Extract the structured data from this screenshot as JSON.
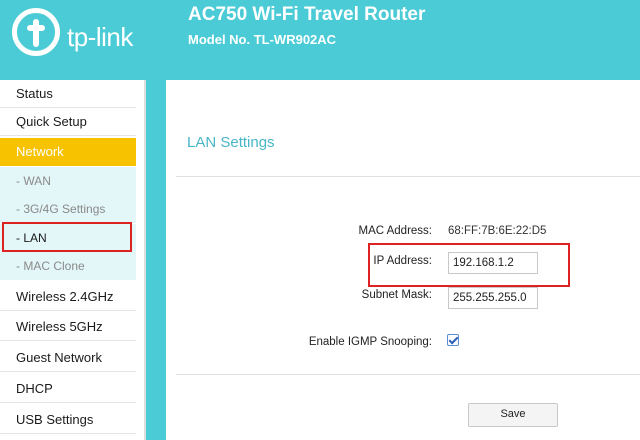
{
  "brand": {
    "logo_text": "tp-link",
    "title": "AC750 Wi-Fi Travel Router",
    "model": "Model No. TL-WR902AC"
  },
  "sidebar": {
    "items": [
      {
        "label": "Status"
      },
      {
        "label": "Quick Setup"
      },
      {
        "label": "Network"
      },
      {
        "label": "- WAN"
      },
      {
        "label": "- 3G/4G Settings"
      },
      {
        "label": "- LAN"
      },
      {
        "label": "- MAC Clone"
      },
      {
        "label": "Wireless 2.4GHz"
      },
      {
        "label": "Wireless 5GHz"
      },
      {
        "label": "Guest Network"
      },
      {
        "label": "DHCP"
      },
      {
        "label": "USB Settings"
      }
    ]
  },
  "lan": {
    "title": "LAN Settings",
    "mac_label": "MAC Address:",
    "mac_value": "68:FF:7B:6E:22:D5",
    "ip_label": "IP Address:",
    "ip_value": "192.168.1.2",
    "mask_label": "Subnet Mask:",
    "mask_value": "255.255.255.0",
    "igmp_label": "Enable IGMP Snooping:",
    "igmp_checked": true,
    "save_label": "Save"
  },
  "colors": {
    "brand_teal": "#4acbd6",
    "active_nav": "#f7c200",
    "highlight_red": "#dd2222",
    "title_teal": "#48b6c6"
  }
}
